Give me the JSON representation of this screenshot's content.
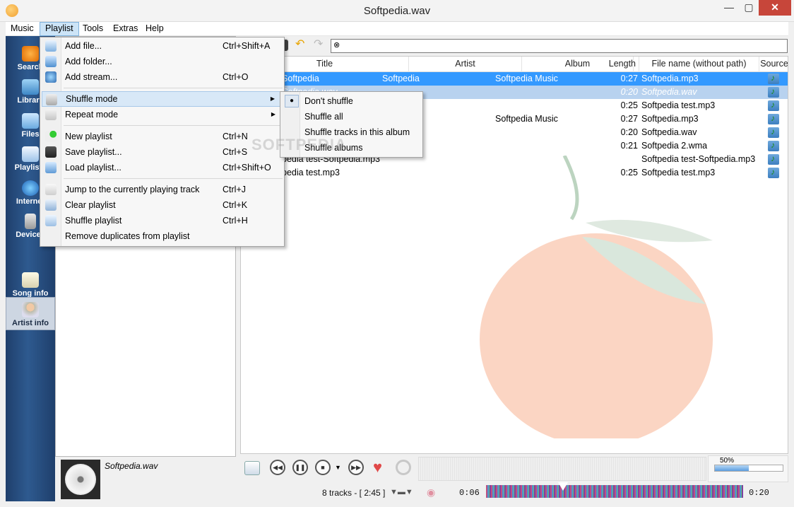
{
  "window": {
    "title": "Softpedia.wav"
  },
  "menubar": [
    "Music",
    "Playlist",
    "Tools",
    "Extras",
    "Help"
  ],
  "nav": [
    {
      "label": "Search",
      "icon": "search-icon"
    },
    {
      "label": "Library",
      "icon": "library-icon"
    },
    {
      "label": "Files",
      "icon": "folder-icon"
    },
    {
      "label": "Playlists",
      "icon": "playlist-icon"
    },
    {
      "label": "Internet",
      "icon": "globe-icon"
    },
    {
      "label": "Devices",
      "icon": "device-icon"
    },
    {
      "label": "Song info",
      "icon": "song-info-icon"
    },
    {
      "label": "Artist info",
      "icon": "artist-icon"
    }
  ],
  "table": {
    "columns": [
      "Title",
      "Artist",
      "Album",
      "Length",
      "File name (without path)",
      "Source"
    ],
    "rows": [
      {
        "title": "Softpedia",
        "artist": "Softpedia",
        "album": "Softpedia Music",
        "length": "0:27",
        "file": "Softpedia.mp3"
      },
      {
        "title": "Softpedia.wav",
        "artist": "",
        "album": "",
        "length": "0:20",
        "file": "Softpedia.wav"
      },
      {
        "title": "",
        "artist": "",
        "album": "",
        "length": "0:25",
        "file": "Softpedia test.mp3"
      },
      {
        "title": "",
        "artist": "",
        "album": "Softpedia Music",
        "length": "0:27",
        "file": "Softpedia.mp3"
      },
      {
        "title": "",
        "artist": "",
        "album": "",
        "length": "0:20",
        "file": "Softpedia.wav"
      },
      {
        "title": "",
        "artist": "",
        "album": "",
        "length": "0:21",
        "file": "Softpedia 2.wma"
      },
      {
        "title": "pedia test-Softpedia.mp3",
        "artist": "",
        "album": "",
        "length": "",
        "file": "Softpedia test-Softpedia.mp3"
      },
      {
        "title": "pedia test.mp3",
        "artist": "",
        "album": "",
        "length": "0:25",
        "file": "Softpedia test.mp3"
      }
    ]
  },
  "playlist_menu": [
    {
      "label": "Add file...",
      "shortcut": "Ctrl+Shift+A",
      "icon": "add-file-icon"
    },
    {
      "label": "Add folder...",
      "shortcut": "",
      "icon": "add-folder-icon"
    },
    {
      "label": "Add stream...",
      "shortcut": "Ctrl+O",
      "icon": "add-stream-icon"
    },
    {
      "label": "Shuffle mode",
      "shortcut": "",
      "icon": "shuffle-icon",
      "submenu": true
    },
    {
      "label": "Repeat mode",
      "shortcut": "",
      "icon": "repeat-icon",
      "submenu": true
    },
    {
      "label": "New playlist",
      "shortcut": "Ctrl+N",
      "icon": "new-playlist-icon"
    },
    {
      "label": "Save playlist...",
      "shortcut": "Ctrl+S",
      "icon": "save-icon"
    },
    {
      "label": "Load playlist...",
      "shortcut": "Ctrl+Shift+O",
      "icon": "load-icon"
    },
    {
      "label": "Jump to the currently playing track",
      "shortcut": "Ctrl+J",
      "icon": "jump-icon"
    },
    {
      "label": "Clear playlist",
      "shortcut": "Ctrl+K",
      "icon": "clear-icon"
    },
    {
      "label": "Shuffle playlist",
      "shortcut": "Ctrl+H",
      "icon": "shuffle-playlist-icon"
    },
    {
      "label": "Remove duplicates from playlist",
      "shortcut": "",
      "icon": ""
    }
  ],
  "shuffle_submenu": [
    "Don't shuffle",
    "Shuffle all",
    "Shuffle tracks in this album",
    "Shuffle albums"
  ],
  "now_playing": {
    "name": "Softpedia.wav"
  },
  "status": {
    "tracks": "8 tracks - [ 2:45 ]",
    "elapsed": "0:06",
    "total": "0:20",
    "volume": "50%",
    "volume_level": 0.5,
    "seek_position": 0.3
  },
  "watermark": "SOFTPEDIA"
}
